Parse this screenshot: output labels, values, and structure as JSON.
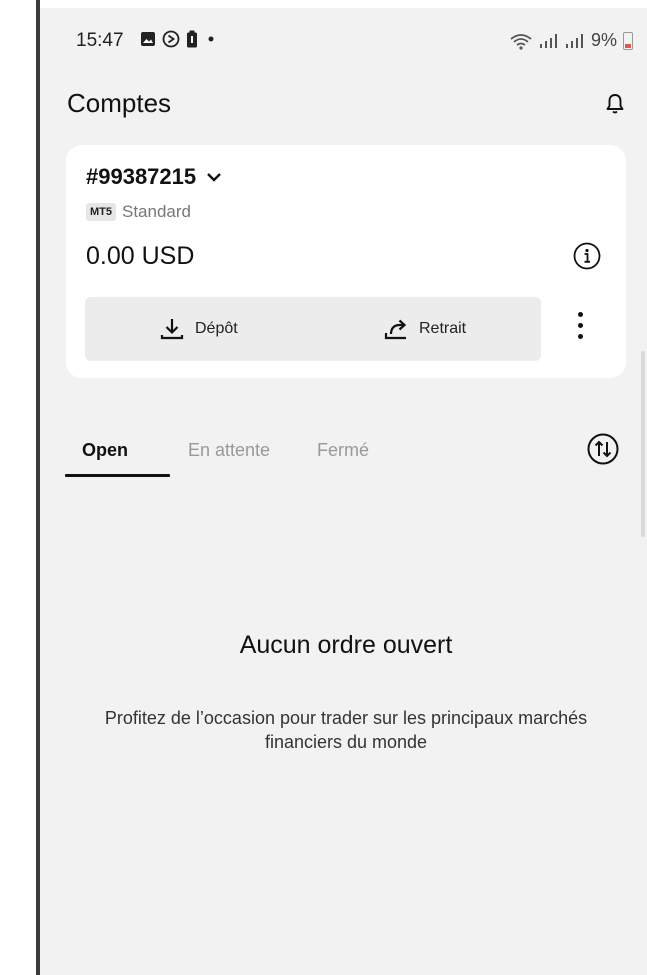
{
  "status_bar": {
    "time": "15:47",
    "left_icons": [
      "gallery-icon",
      "sync-icon",
      "battery-saver-icon",
      "dot-icon"
    ],
    "right_icons": [
      "wifi-icon",
      "signal-icon",
      "signal-icon"
    ],
    "battery_percent": "9%"
  },
  "header": {
    "title": "Comptes",
    "notification_icon": "bell-icon"
  },
  "account": {
    "number": "#99387215",
    "platform_badge": "MT5",
    "type": "Standard",
    "balance": "0.00 USD",
    "deposit_label": "Dépôt",
    "withdraw_label": "Retrait"
  },
  "tabs": [
    {
      "label": "Open",
      "active": true
    },
    {
      "label": "En attente",
      "active": false
    },
    {
      "label": "Fermé",
      "active": false
    }
  ],
  "empty_state": {
    "title": "Aucun ordre ouvert",
    "subtitle": "Profitez de l’occasion pour trader sur les principaux marchés financiers du monde"
  },
  "colors": {
    "background": "#f2f2f2",
    "card": "#ffffff",
    "action_bar": "#ececec",
    "text_primary": "#111111",
    "text_muted": "#999999",
    "battery_low": "#e3564b"
  }
}
